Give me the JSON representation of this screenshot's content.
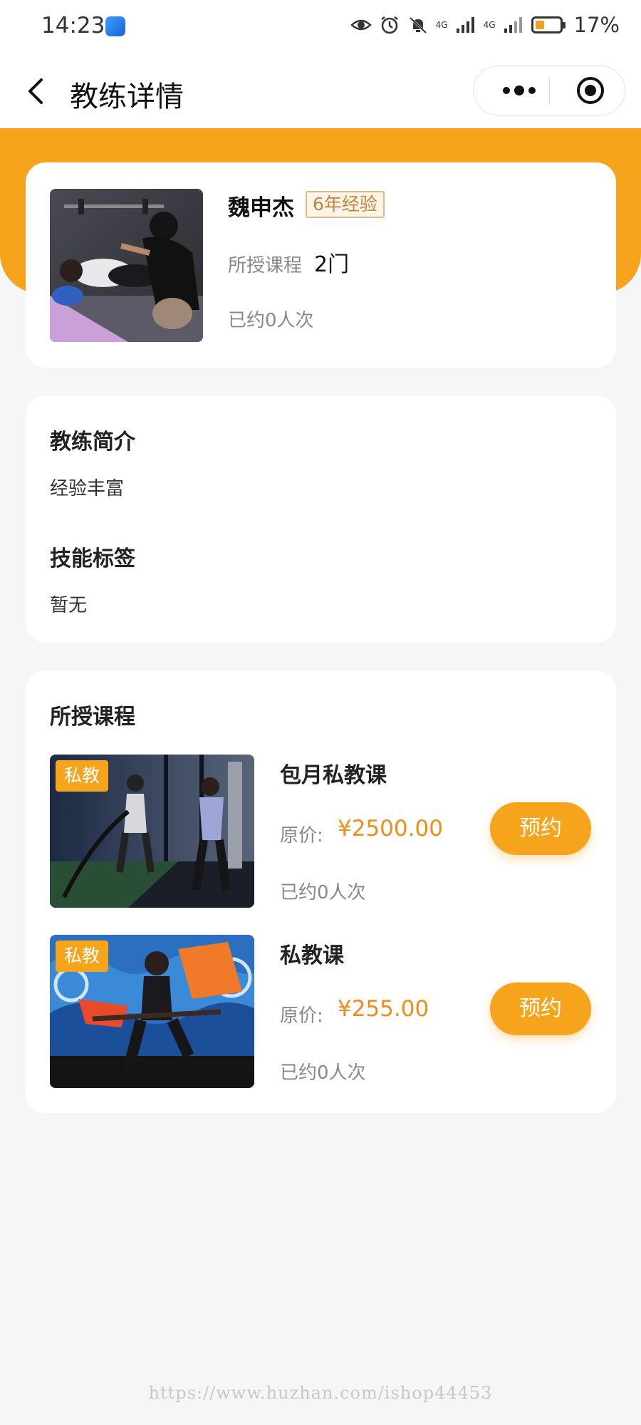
{
  "status_bar": {
    "time": "14:23",
    "network_1": "4G",
    "network_2": "4G",
    "battery_percent_text": "17%",
    "battery_level": 0.17,
    "icons": [
      "eye-icon",
      "alarm-icon",
      "bell-muted-icon",
      "signal-icon",
      "signal-icon",
      "battery-icon"
    ]
  },
  "nav": {
    "title": "教练详情",
    "back_icon": "chevron-left-icon",
    "more_icon": "more-dots-icon",
    "close_icon": "target-circle-icon"
  },
  "coach": {
    "name": "魏申杰",
    "experience": "6年经验",
    "courses_label": "所授课程",
    "courses_count": "2门",
    "booked": "已约0人次"
  },
  "intro": {
    "title": "教练简介",
    "text": "经验丰富",
    "skills_title": "技能标签",
    "skills_text": "暂无"
  },
  "courses_section": {
    "title": "所授课程",
    "items": [
      {
        "tag": "私教",
        "name": "包月私教课",
        "price_label": "原价:",
        "price": "¥2500.00",
        "booked": "已约0人次",
        "button": "预约"
      },
      {
        "tag": "私教",
        "name": "私教课",
        "price_label": "原价:",
        "price": "¥255.00",
        "booked": "已约0人次",
        "button": "预约"
      }
    ]
  },
  "watermark": "https://www.huzhan.com/ishop44453",
  "colors": {
    "accent": "#f6a41c",
    "price": "#f08c17",
    "background": "#f5f6f8"
  }
}
